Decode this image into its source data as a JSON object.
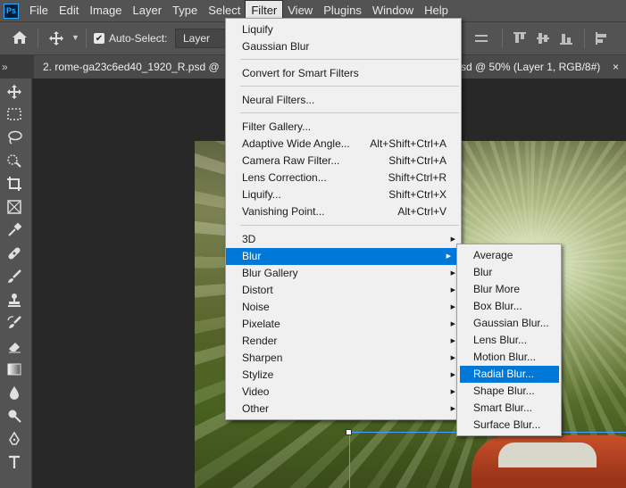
{
  "menubar": {
    "logo": "Ps",
    "items": [
      "File",
      "Edit",
      "Image",
      "Layer",
      "Type",
      "Select",
      "Filter",
      "View",
      "Plugins",
      "Window",
      "Help"
    ],
    "active": "Filter"
  },
  "options": {
    "auto_select_label": "Auto-Select:",
    "auto_select_checked": true,
    "layer_value": "Layer"
  },
  "tabs": {
    "collapse": "»",
    "first": "2. rome-ga23c6ed40_1920_R.psd @",
    "second": "sd @ 50% (Layer 1, RGB/8#)",
    "close": "×"
  },
  "filter_menu": {
    "items": [
      {
        "label": "Liquify",
        "shortcut": ""
      },
      {
        "label": "Gaussian Blur",
        "shortcut": ""
      },
      {
        "label": "Convert for Smart Filters",
        "shortcut": ""
      },
      {
        "label": "Neural Filters...",
        "shortcut": ""
      },
      {
        "label": "Filter Gallery...",
        "shortcut": ""
      },
      {
        "label": "Adaptive Wide Angle...",
        "shortcut": "Alt+Shift+Ctrl+A"
      },
      {
        "label": "Camera Raw Filter...",
        "shortcut": "Shift+Ctrl+A"
      },
      {
        "label": "Lens Correction...",
        "shortcut": "Shift+Ctrl+R"
      },
      {
        "label": "Liquify...",
        "shortcut": "Shift+Ctrl+X"
      },
      {
        "label": "Vanishing Point...",
        "shortcut": "Alt+Ctrl+V"
      },
      {
        "label": "3D",
        "submenu": true
      },
      {
        "label": "Blur",
        "submenu": true,
        "highlighted": true
      },
      {
        "label": "Blur Gallery",
        "submenu": true
      },
      {
        "label": "Distort",
        "submenu": true
      },
      {
        "label": "Noise",
        "submenu": true
      },
      {
        "label": "Pixelate",
        "submenu": true
      },
      {
        "label": "Render",
        "submenu": true
      },
      {
        "label": "Sharpen",
        "submenu": true
      },
      {
        "label": "Stylize",
        "submenu": true
      },
      {
        "label": "Video",
        "submenu": true
      },
      {
        "label": "Other",
        "submenu": true
      }
    ]
  },
  "blur_submenu": {
    "items": [
      "Average",
      "Blur",
      "Blur More",
      "Box Blur...",
      "Gaussian Blur...",
      "Lens Blur...",
      "Motion Blur...",
      "Radial Blur...",
      "Shape Blur...",
      "Smart Blur...",
      "Surface Blur..."
    ],
    "highlighted": "Radial Blur..."
  },
  "tools": [
    "move-icon",
    "marquee-icon",
    "lasso-icon",
    "quick-select-icon",
    "crop-icon",
    "frame-icon",
    "eyedropper-icon",
    "healing-icon",
    "brush-icon",
    "stamp-icon",
    "history-brush-icon",
    "eraser-icon",
    "gradient-icon",
    "blur-drop-icon",
    "dodge-icon",
    "pen-icon",
    "type-icon"
  ],
  "colors": {
    "menu_highlight": "#0078d7",
    "chrome": "#535353"
  }
}
